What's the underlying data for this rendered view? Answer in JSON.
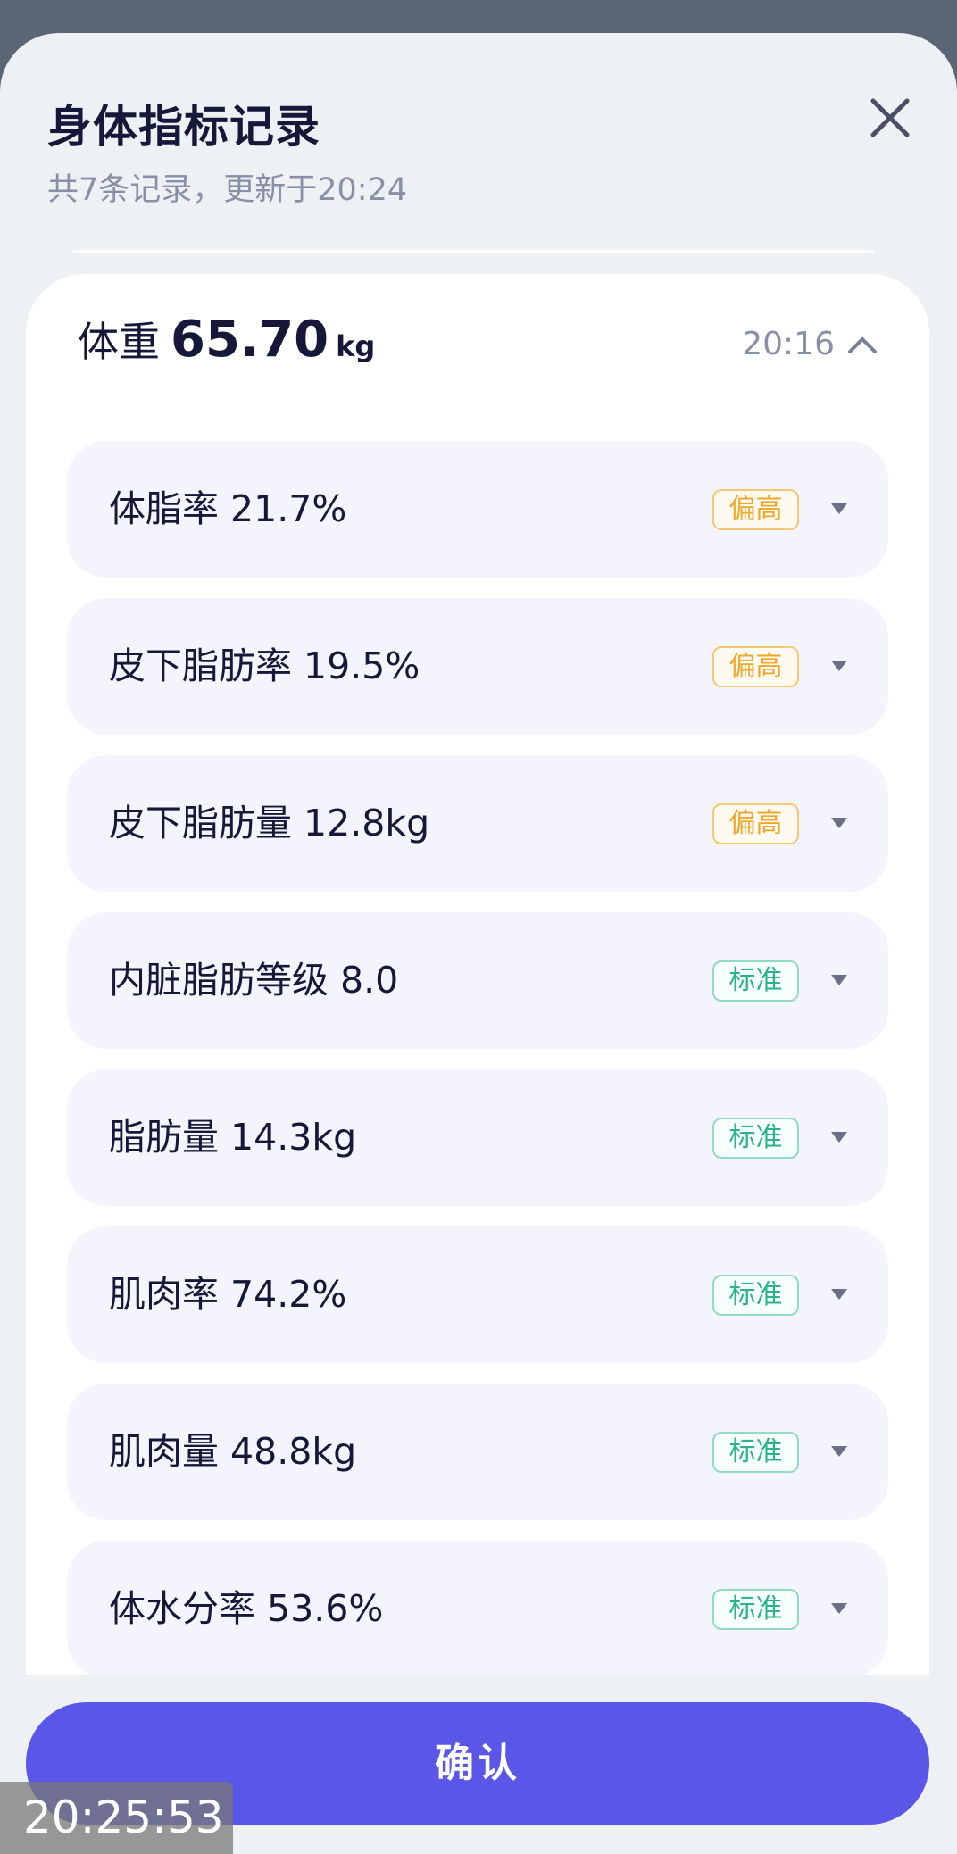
{
  "header": {
    "title": "身体指标记录",
    "subtitle": "共7条记录，更新于20:24"
  },
  "record": {
    "weight_label": "体重",
    "weight_value": "65.70",
    "weight_unit": "kg",
    "time": "20:16"
  },
  "metrics": [
    {
      "label": "体脂率 21.7%",
      "status": "偏高",
      "level": "high"
    },
    {
      "label": "皮下脂肪率 19.5%",
      "status": "偏高",
      "level": "high"
    },
    {
      "label": "皮下脂肪量 12.8kg",
      "status": "偏高",
      "level": "high"
    },
    {
      "label": "内脏脂肪等级 8.0",
      "status": "标准",
      "level": "normal"
    },
    {
      "label": "脂肪量 14.3kg",
      "status": "标准",
      "level": "normal"
    },
    {
      "label": "肌肉率 74.2%",
      "status": "标准",
      "level": "normal"
    },
    {
      "label": "肌肉量 48.8kg",
      "status": "标准",
      "level": "normal"
    },
    {
      "label": "体水分率 53.6%",
      "status": "标准",
      "level": "normal"
    }
  ],
  "confirm_label": "确认",
  "clock_overlay": "20:25:53",
  "colors": {
    "accent": "#5956e8",
    "high": "#f0a62a",
    "normal": "#2bb48a"
  },
  "icons": {
    "close": "close-icon",
    "collapse": "chevron-up-icon",
    "expand": "caret-down-icon"
  }
}
